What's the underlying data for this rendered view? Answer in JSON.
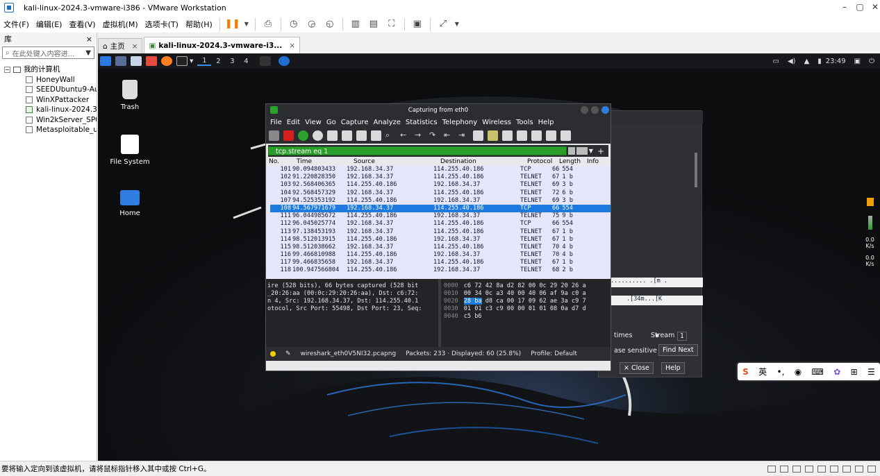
{
  "window": {
    "title": "kali-linux-2024.3-vmware-i386 - VMware Workstation"
  },
  "menu": {
    "items": [
      "文件(F)",
      "编辑(E)",
      "查看(V)",
      "虚拟机(M)",
      "选项卡(T)",
      "帮助(H)"
    ]
  },
  "library": {
    "title": "库",
    "close": "×",
    "search_placeholder": "在此处键入内容进...",
    "root": "我的计算机",
    "vms": [
      {
        "name": "HoneyWall",
        "running": false
      },
      {
        "name": "SEEDUbuntu9-Au",
        "running": false
      },
      {
        "name": "WinXPattacker",
        "running": false
      },
      {
        "name": "kali-linux-2024.3-",
        "running": true
      },
      {
        "name": "Win2kServer_SP0",
        "running": false
      },
      {
        "name": "Metasploitable_u",
        "running": false
      }
    ]
  },
  "tabs": [
    {
      "label": "主页"
    },
    {
      "label": "kali-linux-2024.3-vmware-i3..."
    }
  ],
  "guest": {
    "workspaces": [
      "1",
      "2",
      "3",
      "4"
    ],
    "clock": "23:49",
    "desktop_icons": [
      {
        "label": "Trash"
      },
      {
        "label": "File System"
      },
      {
        "label": "Home"
      }
    ],
    "wireshark": {
      "title": "Capturing from eth0",
      "menu": [
        "File",
        "Edit",
        "View",
        "Go",
        "Capture",
        "Analyze",
        "Statistics",
        "Telephony",
        "Wireless",
        "Tools",
        "Help"
      ],
      "filter": "tcp.stream eq 1",
      "columns": [
        "No.",
        "Time",
        "Source",
        "Destination",
        "Protocol",
        "Length",
        "Info"
      ],
      "packets": [
        [
          "101",
          "90.094803433",
          "192.168.34.37",
          "114.255.40.186",
          "TCP",
          "66",
          "554"
        ],
        [
          "102",
          "91.220828350",
          "192.168.34.37",
          "114.255.40.186",
          "TELNET",
          "67",
          "1 b"
        ],
        [
          "103",
          "92.568406365",
          "114.255.40.186",
          "192.168.34.37",
          "TELNET",
          "69",
          "3 b"
        ],
        [
          "104",
          "92.568457329",
          "192.168.34.37",
          "114.255.40.186",
          "TELNET",
          "72",
          "6 b"
        ],
        [
          "107",
          "94.525353192",
          "114.255.40.186",
          "192.168.34.37",
          "TELNET",
          "69",
          "3 b"
        ],
        [
          "108",
          "94.567971679",
          "192.168.34.37",
          "114.255.40.186",
          "TCP",
          "66",
          "554"
        ],
        [
          "111",
          "96.044985672",
          "114.255.40.186",
          "192.168.34.37",
          "TELNET",
          "75",
          "9 b"
        ],
        [
          "112",
          "96.045025774",
          "192.168.34.37",
          "114.255.40.186",
          "TCP",
          "66",
          "554"
        ],
        [
          "113",
          "97.138453193",
          "192.168.34.37",
          "114.255.40.186",
          "TELNET",
          "67",
          "1 b"
        ],
        [
          "114",
          "98.512013915",
          "114.255.40.186",
          "192.168.34.37",
          "TELNET",
          "67",
          "1 b"
        ],
        [
          "115",
          "98.512038662",
          "192.168.34.37",
          "114.255.40.186",
          "TELNET",
          "70",
          "4 b"
        ],
        [
          "116",
          "99.466810988",
          "114.255.40.186",
          "192.168.34.37",
          "TELNET",
          "70",
          "4 b"
        ],
        [
          "117",
          "99.466835658",
          "192.168.34.37",
          "114.255.40.186",
          "TELNET",
          "67",
          "1 b"
        ],
        [
          "118",
          "100.947566804",
          "114.255.40.186",
          "192.168.34.37",
          "TELNET",
          "68",
          "2 b"
        ]
      ],
      "selected_no": "108",
      "details": [
        "ire (528 bits), 66 bytes captured (528 bit",
        "_20:26:aa (00:0c:29:20:26:aa), Dst: c6:72:",
        "n 4, Src: 192.168.34.37, Dst: 114.255.40.1",
        "otocol, Src Port: 55498, Dst Port: 23, Seq:"
      ],
      "hex": [
        {
          "off": "0000",
          "pre": "",
          "hl": "",
          "bytes": "c6 72 42 8a d2 82 00 0c  29 20 26 a"
        },
        {
          "off": "0010",
          "pre": "",
          "hl": "",
          "bytes": "00 34 0c a3 40 00 40 06  af 9a c0 a"
        },
        {
          "off": "0020",
          "pre": "",
          "hl": "28 ba",
          "bytes": " d8 ca 00 17 09 62  ae 3a c9 7"
        },
        {
          "off": "0030",
          "pre": "",
          "hl": "",
          "bytes": "01 01 c3 c9 00 00 01 01  08 0a d7 d"
        },
        {
          "off": "0040",
          "pre": "",
          "hl": "",
          "bytes": "c5 b6"
        }
      ],
      "status": {
        "file": "wireshark_eth0V5NI32.pcapng",
        "packets": "Packets: 233 · Displayed: 60 (25.8%)",
        "profile": "Profile: Default"
      }
    },
    "bg_dialog": {
      "ascii1": "...........  .[m .",
      "ascii2": ".[34m...[K",
      "times": "times",
      "stream_label": "Stream",
      "stream_value": "1",
      "case_sensitive": "ase sensitive",
      "find_next": "Find Next",
      "close": "× Close",
      "help": "Help"
    },
    "tray": {
      "v1": "0.0",
      "u1": "K/s",
      "v2": "0.0",
      "u2": "K/s"
    }
  },
  "ime": {
    "lang": "英"
  },
  "statusbar": {
    "text": "要将输入定向到该虚拟机，请将鼠标指针移入其中或按 Ctrl+G。"
  }
}
